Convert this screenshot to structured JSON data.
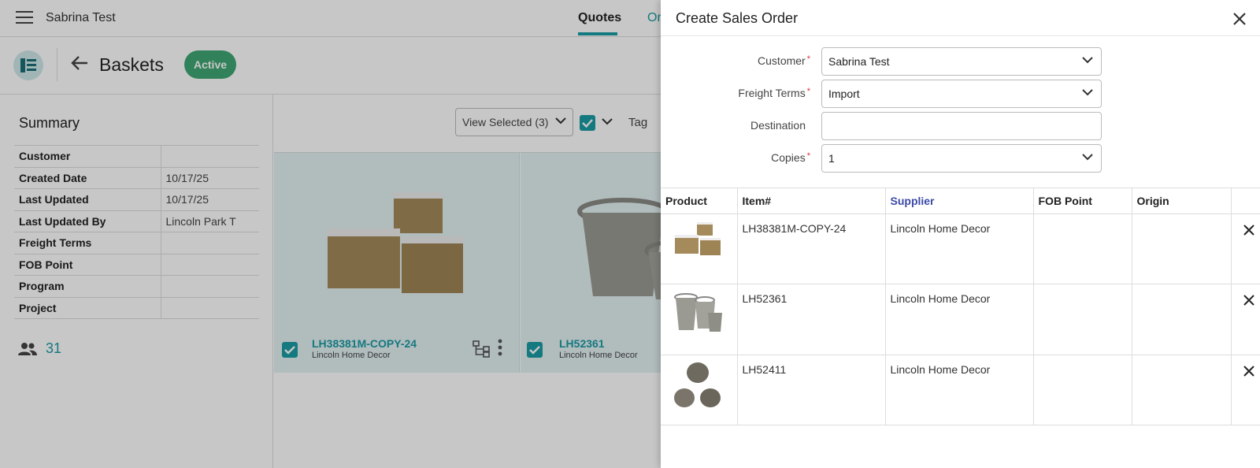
{
  "app": {
    "title": "Sabrina Test",
    "tabs": [
      {
        "label": "Quotes"
      },
      {
        "label": "Or"
      }
    ]
  },
  "header": {
    "title": "Baskets",
    "status": "Active"
  },
  "summary": {
    "title": "Summary",
    "rows": [
      {
        "label": "Customer",
        "value": ""
      },
      {
        "label": "Created Date",
        "value": "10/17/25"
      },
      {
        "label": "Last Updated",
        "value": "10/17/25"
      },
      {
        "label": "Last Updated By",
        "value": "Lincoln Park T"
      },
      {
        "label": "Freight Terms",
        "value": ""
      },
      {
        "label": "FOB Point",
        "value": ""
      },
      {
        "label": "Program",
        "value": ""
      },
      {
        "label": "Project",
        "value": ""
      }
    ],
    "members_count": "31"
  },
  "toolbar": {
    "view_selected": "View Selected (3)",
    "tag": "Tag"
  },
  "cards": [
    {
      "title": "LH38381M-COPY-24",
      "supplier": "Lincoln Home Decor"
    },
    {
      "title": "LH52361",
      "supplier": "Lincoln Home Decor"
    }
  ],
  "drawer": {
    "title": "Create Sales Order",
    "fields": {
      "customer_label": "Customer",
      "customer_value": "Sabrina Test",
      "freight_label": "Freight Terms",
      "freight_value": "Import",
      "destination_label": "Destination",
      "destination_value": "",
      "copies_label": "Copies",
      "copies_value": "1",
      "required_mark": "*"
    },
    "table": {
      "headers": [
        "Product",
        "Item#",
        "Supplier",
        "FOB Point",
        "Origin",
        ""
      ],
      "rows": [
        {
          "item": "LH38381M-COPY-24",
          "supplier": "Lincoln Home Decor",
          "fob": "",
          "origin": ""
        },
        {
          "item": "LH52361",
          "supplier": "Lincoln Home Decor",
          "fob": "",
          "origin": ""
        },
        {
          "item": "LH52411",
          "supplier": "Lincoln Home Decor",
          "fob": "",
          "origin": ""
        }
      ]
    }
  },
  "colors": {
    "accent": "#1c9ba5",
    "status_active": "#3fa774",
    "supplier_header": "#3d4aa8",
    "required": "#dd3333"
  }
}
